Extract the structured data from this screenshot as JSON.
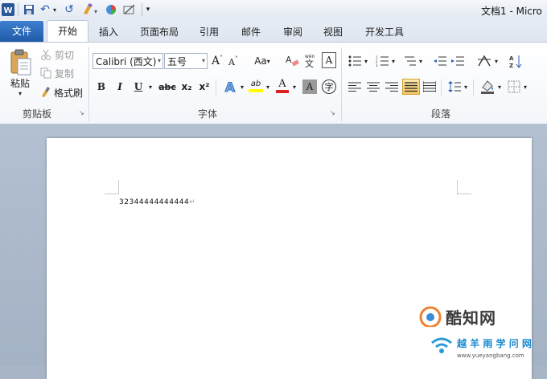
{
  "quick_access": {
    "undo_label": "↶",
    "redo_label": "↺",
    "menu_label": "▾"
  },
  "window": {
    "title": "文档1 - Micro"
  },
  "tabs": [
    {
      "label": "文件"
    },
    {
      "label": "开始"
    },
    {
      "label": "插入"
    },
    {
      "label": "页面布局"
    },
    {
      "label": "引用"
    },
    {
      "label": "邮件"
    },
    {
      "label": "审阅"
    },
    {
      "label": "视图"
    },
    {
      "label": "开发工具"
    }
  ],
  "clipboard": {
    "paste_label": "粘贴",
    "cut_label": "剪切",
    "copy_label": "复制",
    "format_painter_label": "格式刷",
    "group_label": "剪贴板"
  },
  "font": {
    "font_name": "Calibri (西文)",
    "font_size": "五号",
    "grow_label": "A",
    "shrink_label": "A",
    "case_label": "Aa",
    "clear_label": "A",
    "phonetic_label": "变",
    "border_char_label": "A",
    "bold_label": "B",
    "italic_label": "I",
    "underline_label": "U",
    "strike_label": "abc",
    "subscript_label": "x₂",
    "superscript_label": "x²",
    "effects_label": "A",
    "highlight_label": "ab",
    "color_label": "A",
    "shading_label": "A",
    "enclose_label": "字",
    "group_label": "字体",
    "highlight_color": "#ffff00",
    "font_color": "#e02020"
  },
  "paragraph": {
    "group_label": "段落"
  },
  "document": {
    "text": "32344444444444"
  },
  "watermark": {
    "logo_text": "酷知网",
    "site_text": "越 羊 雨 学 问 网",
    "url_text": "www.yueyangbang.com"
  }
}
